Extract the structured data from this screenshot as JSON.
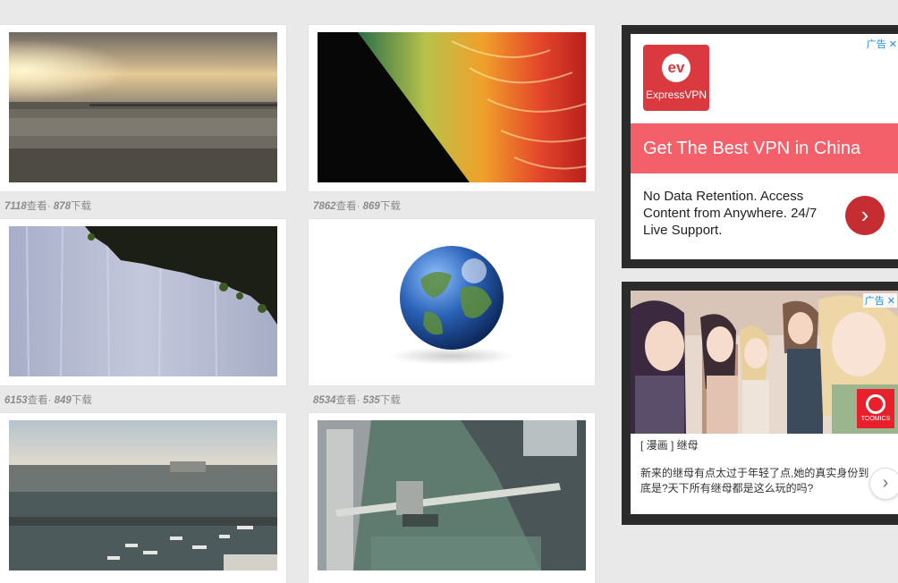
{
  "gallery": [
    {
      "views": "7118",
      "views_unit": "查看·",
      "downloads": "878",
      "downloads_unit": "下载",
      "subject": "sunset over beach pier"
    },
    {
      "views": "7862",
      "views_unit": "查看·",
      "downloads": "869",
      "downloads_unit": "下载",
      "subject": "rainbow light streaks"
    },
    {
      "views": "6153",
      "views_unit": "查看·",
      "downloads": "849",
      "downloads_unit": "下载",
      "subject": "waterfall under cliff"
    },
    {
      "views": "8534",
      "views_unit": "查看·",
      "downloads": "535",
      "downloads_unit": "下载",
      "subject": "earth globe"
    },
    {
      "subject": "marina with boats"
    },
    {
      "subject": "bridge over canal"
    }
  ],
  "ads": {
    "adchoices_label": "广告",
    "close_glyph": "✕",
    "vpn": {
      "logo_mark": "ev",
      "logo_text": "ExpressVPN",
      "headline": "Get The Best VPN in China",
      "description": "No Data Retention. Access Content from Anywhere. 24/7 Live Support.",
      "cta_glyph": "›",
      "colors": {
        "brand": "#da3940",
        "band": "#f4606a",
        "button": "#c62d33"
      }
    },
    "manga": {
      "brand_text": "TOOMICS",
      "title": "[ 漫画 ] 继母",
      "text": "新来的继母有点太过于年轻了点,她的真实身份到底是?天下所有继母都是这么玩的吗?",
      "cta_glyph": "›"
    }
  }
}
